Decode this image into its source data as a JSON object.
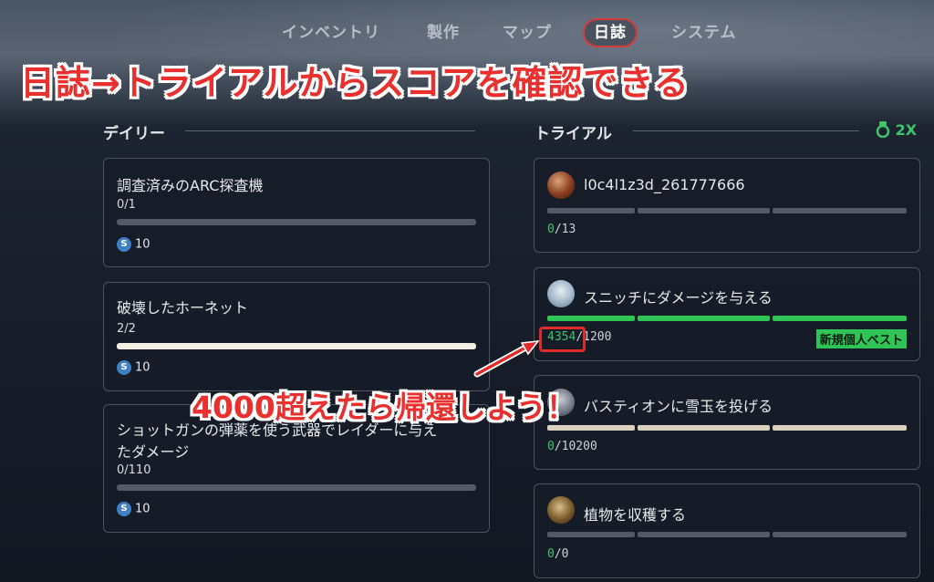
{
  "nav": {
    "tabs": [
      {
        "label": "インベントリ"
      },
      {
        "label": "製作"
      },
      {
        "label": "マップ"
      },
      {
        "label": "日誌"
      },
      {
        "label": "システム"
      }
    ]
  },
  "annotation": {
    "banner": "日誌→トライアルからスコアを確認できる",
    "callout": "4000超えたら帰還しよう！"
  },
  "daily": {
    "heading": "デイリー",
    "cards": [
      {
        "title": "調査済みのARC探査機",
        "progress": "0/1",
        "fill": 0,
        "reward": "10"
      },
      {
        "title": "破壊したホーネット",
        "progress": "2/2",
        "fill": 1,
        "reward": "10"
      },
      {
        "title_line1": "ショットガンの弾薬を使う武器でレイダーに与え",
        "title_line2": "たダメージ",
        "progress": "0/110",
        "fill": 0,
        "reward": "10"
      }
    ]
  },
  "trial": {
    "heading": "トライアル",
    "multiplier": "2X",
    "cards": [
      {
        "title": "l0c4l1z3d_261777666",
        "current": "0",
        "total": "/13",
        "bar_state": "empty"
      },
      {
        "title": "スニッチにダメージを与える",
        "current": "4354",
        "total": "/1200",
        "bar_state": "full",
        "badge": "新規個人ベスト"
      },
      {
        "title": "バスティオンに雪玉を投げる",
        "current": "0",
        "total": "/10200",
        "bar_state": "cream"
      },
      {
        "title": "植物を収穫する",
        "current": "0",
        "total": "/0",
        "bar_state": "empty"
      }
    ]
  },
  "colors": {
    "accent_red": "#e8312e",
    "progress_green": "#2fc456",
    "coin_blue": "#3f7fc4"
  }
}
